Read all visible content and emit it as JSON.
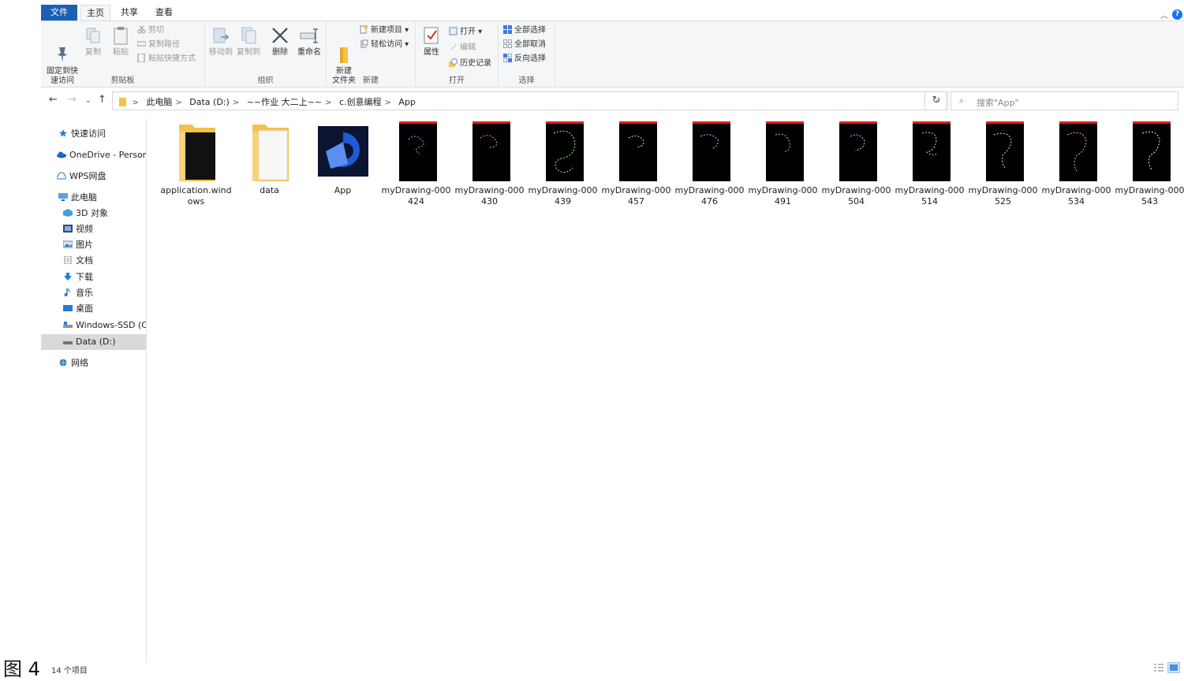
{
  "ribbon": {
    "tabs": [
      "文件",
      "主页",
      "共享",
      "查看"
    ],
    "clipboard": {
      "pin_label": "固定到快\n速访问",
      "copy_label": "复制",
      "paste_label": "粘贴",
      "cut_label": "剪切",
      "copy_path_label": "复制路径",
      "paste_shortcut_label": "粘贴快捷方式",
      "group_label": "剪贴板"
    },
    "organize": {
      "move_to_label": "移动到",
      "copy_to_label": "复制到",
      "delete_label": "删除",
      "rename_label": "重命名",
      "group_label": "组织"
    },
    "new": {
      "new_folder_label": "新建\n文件夹",
      "new_item_label": "新建项目 ▾",
      "easy_access_label": "轻松访问 ▾",
      "group_label": "新建"
    },
    "open": {
      "properties_label": "属性",
      "open_label": "打开 ▾",
      "edit_label": "编辑",
      "history_label": "历史记录",
      "group_label": "打开"
    },
    "select": {
      "select_all_label": "全部选择",
      "select_none_label": "全部取消",
      "invert_label": "反向选择",
      "group_label": "选择"
    }
  },
  "address": {
    "crumbs": [
      "此电脑",
      "Data (D:)",
      "~~作业 大二上~~",
      "c.创意编程",
      "App"
    ],
    "search_placeholder": "搜索\"App\""
  },
  "nav_pane": {
    "items": [
      {
        "label": "快速访问",
        "icon": "star-icon"
      },
      {
        "label": "OneDrive - Persona",
        "icon": "cloud-icon"
      },
      {
        "label": "WPS网盘",
        "icon": "cloud-outline-icon"
      },
      {
        "label": "此电脑",
        "icon": "computer-icon"
      },
      {
        "label": "3D 对象",
        "icon": "cube-icon"
      },
      {
        "label": "视频",
        "icon": "video-icon"
      },
      {
        "label": "图片",
        "icon": "pictures-icon"
      },
      {
        "label": "文档",
        "icon": "documents-icon"
      },
      {
        "label": "下载",
        "icon": "download-icon"
      },
      {
        "label": "音乐",
        "icon": "music-icon"
      },
      {
        "label": "桌面",
        "icon": "desktop-icon"
      },
      {
        "label": "Windows-SSD (C:)",
        "icon": "drive-icon"
      },
      {
        "label": "Data (D:)",
        "icon": "drive-icon"
      },
      {
        "label": "网络",
        "icon": "network-icon"
      }
    ]
  },
  "files": [
    {
      "name": "application.windows",
      "kind": "folder-dark"
    },
    {
      "name": "data",
      "kind": "folder-light"
    },
    {
      "name": "App",
      "kind": "app"
    },
    {
      "name": "myDrawing-000424",
      "kind": "drawing"
    },
    {
      "name": "myDrawing-000430",
      "kind": "drawing"
    },
    {
      "name": "myDrawing-000439",
      "kind": "drawing"
    },
    {
      "name": "myDrawing-000457",
      "kind": "drawing"
    },
    {
      "name": "myDrawing-000476",
      "kind": "drawing"
    },
    {
      "name": "myDrawing-000491",
      "kind": "drawing"
    },
    {
      "name": "myDrawing-000504",
      "kind": "drawing"
    },
    {
      "name": "myDrawing-000514",
      "kind": "drawing"
    },
    {
      "name": "myDrawing-000525",
      "kind": "drawing"
    },
    {
      "name": "myDrawing-000534",
      "kind": "drawing"
    },
    {
      "name": "myDrawing-000543",
      "kind": "drawing"
    }
  ],
  "status": {
    "item_count": "14 个项目"
  },
  "caption": "图 4",
  "colors": {
    "accent": "#1a5fb4",
    "selected": "#d9d9d9",
    "ribbon_bg": "#f5f6f7",
    "thumb_bar": "#e41c1c"
  }
}
